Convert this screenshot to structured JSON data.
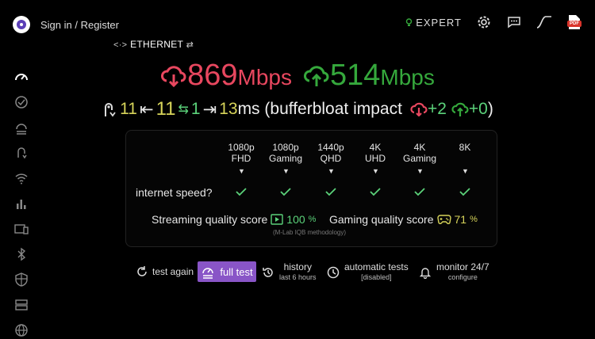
{
  "header": {
    "signin_label": "Sign in / Register",
    "connection_label": "ETHERNET",
    "expert_label": "EXPERT",
    "icons": [
      "settings-icon",
      "chat-icon",
      "graph-icon",
      "pdf-icon"
    ],
    "pdf_label": "PDF"
  },
  "speeds": {
    "download_value": "869",
    "upload_value": "514",
    "unit": "Mbps"
  },
  "latency": {
    "unloaded": "11",
    "down_loaded": "11",
    "jitter": "1",
    "up_loaded": "13",
    "unit_text": "ms (bufferbloat impact",
    "dl_impact": "+2",
    "ul_impact": "+0",
    "close": ")"
  },
  "quality": {
    "columns": [
      {
        "l1": "1080p",
        "l2": "FHD"
      },
      {
        "l1": "1080p",
        "l2": "Gaming"
      },
      {
        "l1": "1440p",
        "l2": "QHD"
      },
      {
        "l1": "4K",
        "l2": "UHD"
      },
      {
        "l1": "4K",
        "l2": "Gaming"
      },
      {
        "l1": "8K",
        "l2": ""
      }
    ],
    "row_label": "internet speed?",
    "streaming_label": "Streaming quality score",
    "streaming_value": "100",
    "gaming_label": "Gaming quality score",
    "gaming_value": "71",
    "pct_symbol": "%",
    "methodology": "(M-Lab IQB methodology)"
  },
  "actions": {
    "test_again": "test again",
    "full_test": "full test",
    "history": "history",
    "history_sub": "last 6 hours",
    "automatic": "automatic tests",
    "automatic_sub": "[disabled]",
    "monitor": "monitor 24/7",
    "monitor_sub": "configure"
  },
  "colors": {
    "download": "#e8475f",
    "upload": "#35a83c",
    "accent": "#8955c7",
    "latency_yellow": "#d7d45a",
    "latency_green": "#5bd27a"
  }
}
